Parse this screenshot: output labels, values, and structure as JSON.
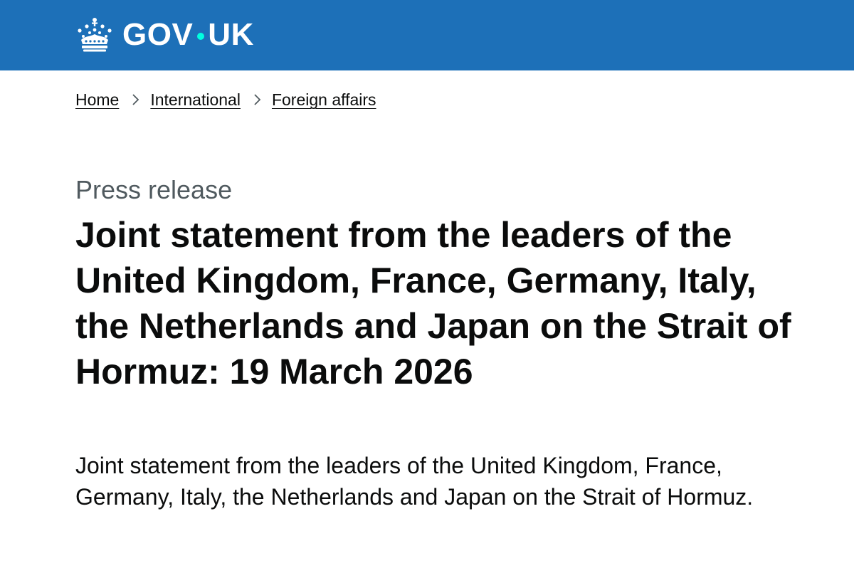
{
  "header": {
    "logo_label": "GOV",
    "logo_label_suffix": "UK",
    "logo_icon": "crown-icon",
    "background_color": "#1d70b8",
    "dot_color": "#00ffe0"
  },
  "breadcrumb": {
    "items": [
      {
        "label": "Home"
      },
      {
        "label": "International"
      },
      {
        "label": "Foreign affairs"
      }
    ],
    "separator_icon": "chevron-right-icon"
  },
  "main": {
    "caption": "Press release",
    "title": "Joint statement from the leaders of the United Kingdom, France, Germany, Italy, the Netherlands and Japan on the Strait of Hormuz: 19 March 2026",
    "lead": "Joint statement from the leaders of the United Kingdom, France, Germany, Italy, the Netherlands and Japan on the Strait of Hormuz."
  }
}
